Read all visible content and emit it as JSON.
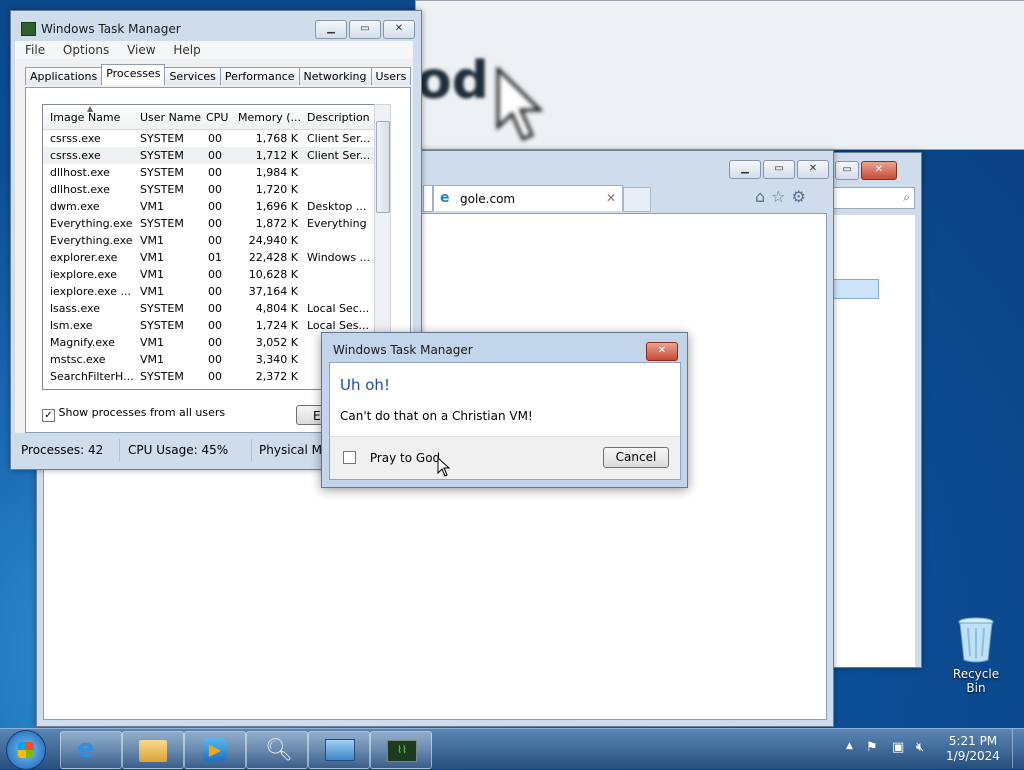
{
  "blurred_window": {
    "text": "od"
  },
  "ie": {
    "tab_label": "gole.com",
    "tab_close": "✕"
  },
  "task_manager": {
    "title": "Windows Task Manager",
    "menu": [
      "File",
      "Options",
      "View",
      "Help"
    ],
    "tabs": [
      "Applications",
      "Processes",
      "Services",
      "Performance",
      "Networking",
      "Users"
    ],
    "active_tab": "Processes",
    "columns": [
      "Image Name",
      "User Name",
      "CPU",
      "Memory (...",
      "Description"
    ],
    "rows": [
      {
        "name": "csrss.exe",
        "user": "SYSTEM",
        "cpu": "00",
        "mem": "1,768 K",
        "desc": "Client Ser..."
      },
      {
        "name": "csrss.exe",
        "user": "SYSTEM",
        "cpu": "00",
        "mem": "1,712 K",
        "desc": "Client Ser..."
      },
      {
        "name": "dllhost.exe",
        "user": "SYSTEM",
        "cpu": "00",
        "mem": "1,984 K",
        "desc": ""
      },
      {
        "name": "dllhost.exe",
        "user": "SYSTEM",
        "cpu": "00",
        "mem": "1,720 K",
        "desc": ""
      },
      {
        "name": "dwm.exe",
        "user": "VM1",
        "cpu": "00",
        "mem": "1,696 K",
        "desc": "Desktop ..."
      },
      {
        "name": "Everything.exe",
        "user": "SYSTEM",
        "cpu": "00",
        "mem": "1,872 K",
        "desc": "Everything"
      },
      {
        "name": "Everything.exe",
        "user": "VM1",
        "cpu": "00",
        "mem": "24,940 K",
        "desc": ""
      },
      {
        "name": "explorer.exe",
        "user": "VM1",
        "cpu": "01",
        "mem": "22,428 K",
        "desc": "Windows ..."
      },
      {
        "name": "iexplore.exe",
        "user": "VM1",
        "cpu": "00",
        "mem": "10,628 K",
        "desc": ""
      },
      {
        "name": "iexplore.exe ...",
        "user": "VM1",
        "cpu": "00",
        "mem": "37,164 K",
        "desc": ""
      },
      {
        "name": "lsass.exe",
        "user": "SYSTEM",
        "cpu": "00",
        "mem": "4,804 K",
        "desc": "Local Sec..."
      },
      {
        "name": "lsm.exe",
        "user": "SYSTEM",
        "cpu": "00",
        "mem": "1,724 K",
        "desc": "Local Ses..."
      },
      {
        "name": "Magnify.exe",
        "user": "VM1",
        "cpu": "00",
        "mem": "3,052 K",
        "desc": ""
      },
      {
        "name": "mstsc.exe",
        "user": "VM1",
        "cpu": "00",
        "mem": "3,340 K",
        "desc": ""
      },
      {
        "name": "SearchFilterH...",
        "user": "SYSTEM",
        "cpu": "00",
        "mem": "2,372 K",
        "desc": ""
      }
    ],
    "selected_row": 1,
    "show_all_label": "Show processes from all users",
    "show_all_checked": true,
    "end_button_label": "E",
    "status": {
      "processes": "Processes: 42",
      "cpu": "CPU Usage: 45%",
      "memory": "Physical Me"
    }
  },
  "dialog": {
    "title": "Windows Task Manager",
    "heading": "Uh oh!",
    "message": "Can't do that on a Christian VM!",
    "checkbox_label": "Pray to God",
    "checkbox_checked": false,
    "cancel_label": "Cancel",
    "colors": {
      "heading": "#1e4fa8"
    }
  },
  "desktop": {
    "recycle_bin_label": "Recycle Bin"
  },
  "taskbar": {
    "time": "5:21 PM",
    "date": "1/9/2024",
    "items": [
      "ie-icon",
      "explorer-icon",
      "media-player-icon",
      "magnifier-icon",
      "remote-desktop-icon",
      "task-manager-icon"
    ]
  }
}
